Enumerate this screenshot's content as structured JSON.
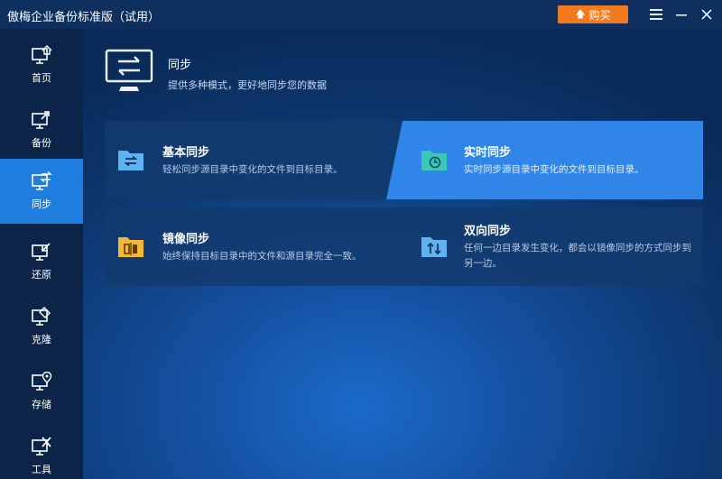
{
  "window": {
    "title": "傲梅企业备份标准版（试用）"
  },
  "toolbar": {
    "buy_label": "购买",
    "menu_icon": "menu-icon",
    "minimize_icon": "minimize-icon",
    "close_icon": "close-icon"
  },
  "sidebar": {
    "items": [
      {
        "label": "首页",
        "icon": "home-icon",
        "active": false
      },
      {
        "label": "备份",
        "icon": "backup-icon",
        "active": false
      },
      {
        "label": "同步",
        "icon": "sync-icon",
        "active": true
      },
      {
        "label": "还原",
        "icon": "restore-icon",
        "active": false
      },
      {
        "label": "克隆",
        "icon": "clone-icon",
        "active": false
      },
      {
        "label": "存储",
        "icon": "storage-icon",
        "active": false
      },
      {
        "label": "工具",
        "icon": "tools-icon",
        "active": false
      }
    ]
  },
  "header": {
    "title": "同步",
    "subtitle": "提供多种模式，更好地同步您的数据"
  },
  "cards": [
    {
      "title": "基本同步",
      "desc": "轻松同步源目录中变化的文件到目标目录。",
      "icon": "basic-sync-folder-icon",
      "highlighted": false
    },
    {
      "title": "实时同步",
      "desc": "实时同步源目录中变化的文件到目标目录。",
      "icon": "realtime-sync-folder-icon",
      "highlighted": true
    },
    {
      "title": "镜像同步",
      "desc": "始终保持目标目录中的文件和源目录完全一致。",
      "icon": "mirror-sync-folder-icon",
      "highlighted": false
    },
    {
      "title": "双向同步",
      "desc": "任何一边目录发生变化，都会以镜像同步的方式同步到另一边。",
      "icon": "two-way-sync-folder-icon",
      "highlighted": false
    }
  ],
  "colors": {
    "accent": "#1f7de0",
    "buy": "#f47a1f",
    "highlight_card": "#2f86e8",
    "card": "#123a6e",
    "sidebar": "#0b2448"
  }
}
